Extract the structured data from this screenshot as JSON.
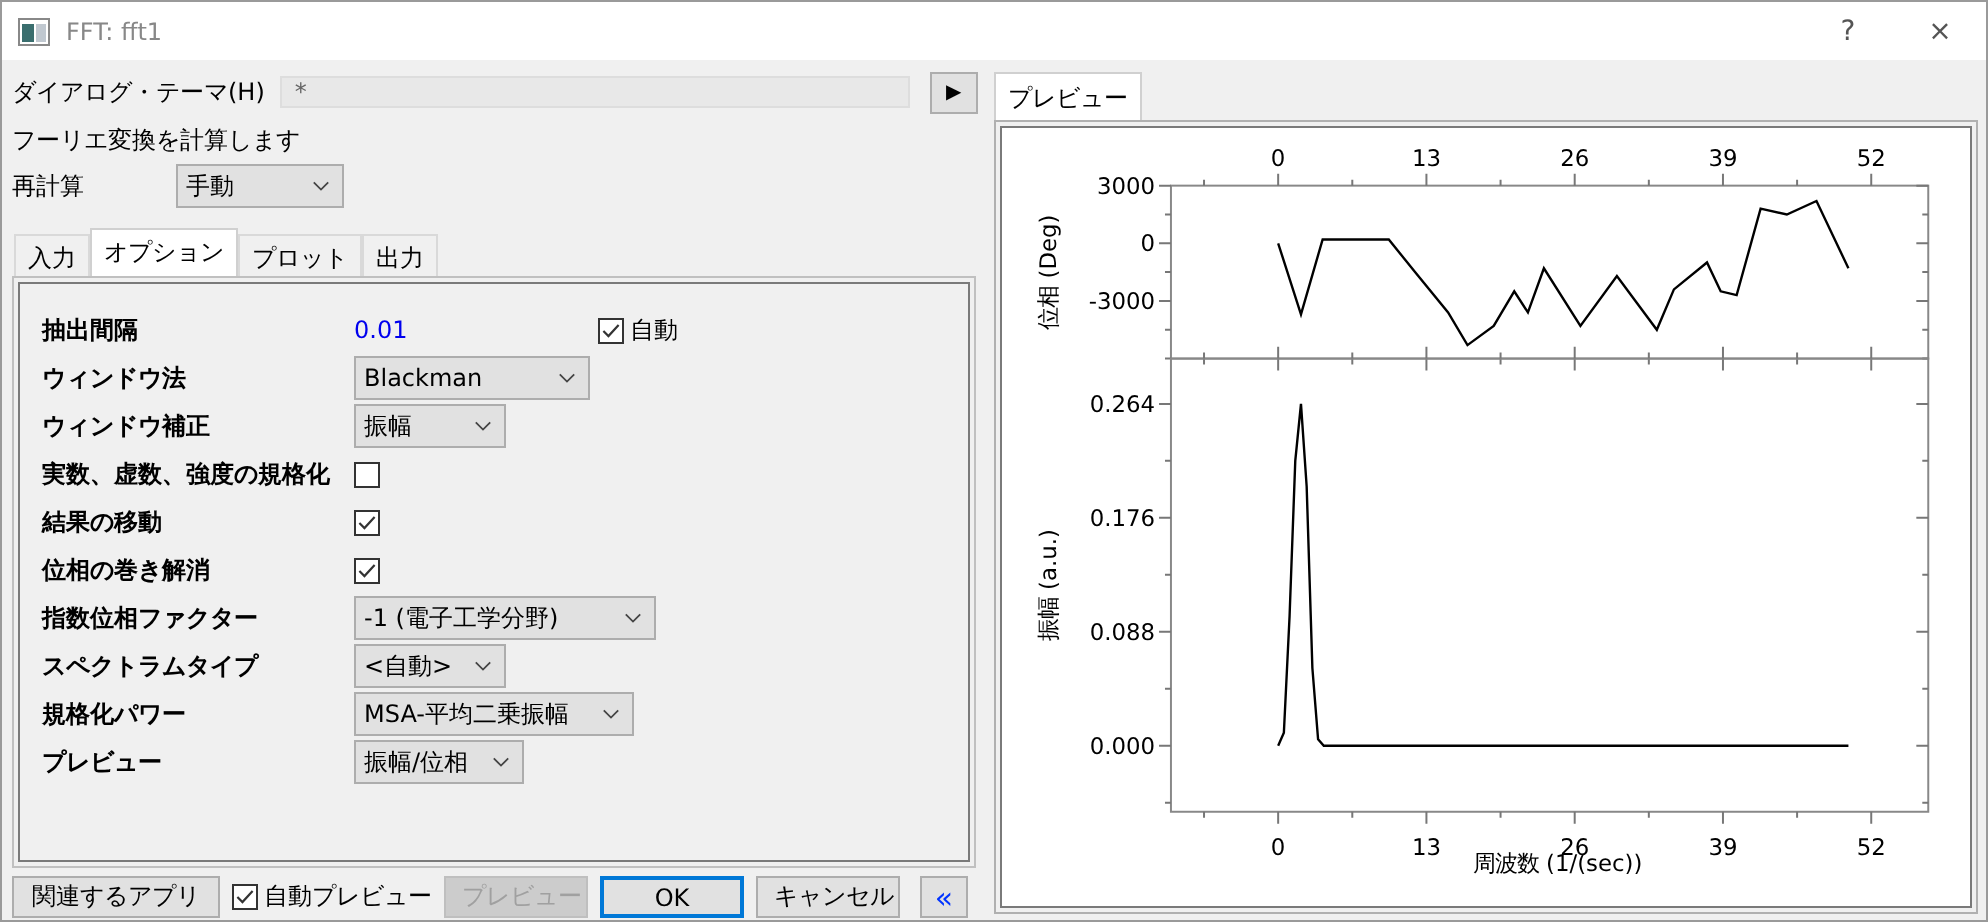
{
  "window": {
    "title": "FFT: fft1",
    "buttons": [
      "?",
      "×"
    ]
  },
  "theme": {
    "label": "ダイアログ・テーマ(H)",
    "value": "*",
    "button": "▶"
  },
  "description": "フーリエ変換を計算します",
  "recalc": {
    "label": "再計算",
    "value": "手動"
  },
  "tabs": [
    {
      "label": "入力",
      "selected": false
    },
    {
      "label": "オプション",
      "selected": true
    },
    {
      "label": "プロット",
      "selected": false
    },
    {
      "label": "出力",
      "selected": false
    }
  ],
  "options": [
    {
      "kind": "value",
      "label": "抽出間隔",
      "value": "0.01",
      "check_label": "自動",
      "checked": true
    },
    {
      "kind": "select",
      "label": "ウィンドウ法",
      "value": "Blackman"
    },
    {
      "kind": "select",
      "label": "ウィンドウ補正",
      "value": "振幅"
    },
    {
      "kind": "checkbox",
      "label": "実数、虚数、強度の規格化",
      "checked": false
    },
    {
      "kind": "checkbox",
      "label": "結果の移動",
      "checked": true
    },
    {
      "kind": "checkbox",
      "label": "位相の巻き解消",
      "checked": true
    },
    {
      "kind": "select",
      "label": "指数位相ファクター",
      "value": "-1 (電子工学分野)"
    },
    {
      "kind": "select",
      "label": "スペクトラムタイプ",
      "value": "<自動>"
    },
    {
      "kind": "select",
      "label": "規格化パワー",
      "value": "MSA-平均二乗振幅"
    },
    {
      "kind": "select",
      "label": "プレビュー",
      "value": "振幅/位相"
    }
  ],
  "footer": {
    "related": "関連するアプリ",
    "auto_preview": {
      "label": "自動プレビュー",
      "checked": true
    },
    "preview": {
      "label": "プレビュー",
      "disabled": true
    },
    "ok": "OK",
    "cancel": "キャンセル",
    "collapse": "«"
  },
  "preview": {
    "tab": "プレビュー",
    "phase": {
      "chart_data": {
        "type": "line",
        "ylabel": "位相 (Deg)",
        "xlim": [
          -9.4,
          57
        ],
        "ylim": [
          -6000,
          3000
        ],
        "xticks": [
          0,
          13,
          26,
          39,
          52
        ],
        "yticks": [
          -3000,
          0,
          3000
        ],
        "x": [
          0,
          2.0,
          3.9,
          9.7,
          12.0,
          14.9,
          16.6,
          18.9,
          20.7,
          21.9,
          23.3,
          26.5,
          29.7,
          33.2,
          34.7,
          37.6,
          38.8,
          40.2,
          42.3,
          44.6,
          47.2,
          50.0
        ],
        "series": [
          {
            "color": "#000000",
            "values": [
              0,
              -3700,
              200,
              200,
              -1500,
              -3600,
              -5300,
              -4300,
              -2500,
              -3600,
              -1300,
              -4300,
              -1700,
              -4500,
              -2400,
              -1000,
              -2500,
              -2700,
              1800,
              1500,
              2200,
              -1300
            ]
          }
        ]
      }
    },
    "amplitude": {
      "chart_data": {
        "type": "line",
        "xlabel": "周波数 (1/(sec))",
        "ylabel": "振幅 (a.u.)",
        "xlim": [
          -9.4,
          57
        ],
        "ylim": [
          -0.051,
          0.299
        ],
        "xticks": [
          0,
          13,
          26,
          39,
          52
        ],
        "yticks": [
          {
            "value": 0,
            "label": "0.000"
          },
          {
            "value": 0.088,
            "label": "0.088"
          },
          {
            "value": 0.176,
            "label": "0.176"
          },
          {
            "value": 0.264,
            "label": "0.264"
          }
        ],
        "x": [
          0,
          0.5,
          1,
          1.5,
          2,
          2.5,
          3,
          3.5,
          4,
          50
        ],
        "series": [
          {
            "color": "#000000",
            "values": [
              0,
              0.01,
              0.1,
              0.22,
              0.264,
              0.2,
              0.06,
              0.005,
              0,
              0
            ]
          }
        ]
      }
    }
  }
}
